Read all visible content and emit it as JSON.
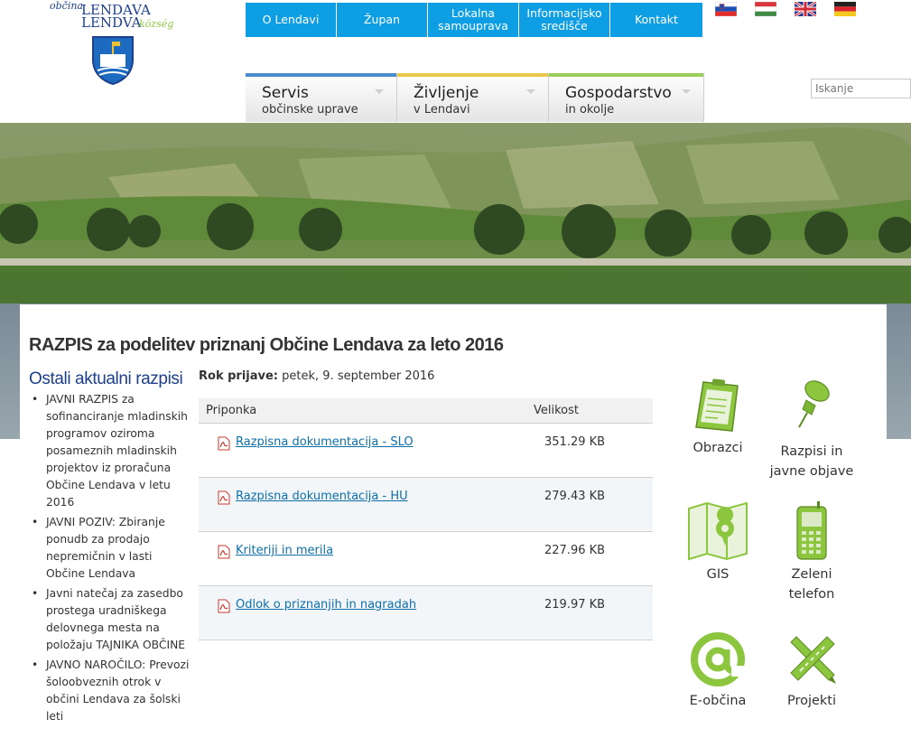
{
  "logo": {
    "line_small": "občina",
    "line1": "LENDAVA",
    "line2": "LENDVA",
    "line2_suffix": "község"
  },
  "top_nav": [
    {
      "label": "O Lendavi"
    },
    {
      "label": "Župan"
    },
    {
      "label": "Lokalna samouprava"
    },
    {
      "label": "Informacijsko središče"
    },
    {
      "label": "Kontakt"
    }
  ],
  "languages": [
    "flag-si-icon",
    "flag-hu-icon",
    "flag-gb-icon",
    "flag-de-icon"
  ],
  "main_nav": [
    {
      "title": "Servis",
      "subtitle": "občinske uprave",
      "color": "#4a8ccc"
    },
    {
      "title": "Življenje",
      "subtitle": "v Lendavi",
      "color": "#e9c74b"
    },
    {
      "title": "Gospodarstvo",
      "subtitle": "in okolje",
      "color": "#9ccc5a"
    }
  ],
  "search": {
    "placeholder": "Iskanje"
  },
  "page_title": "RAZPIS za podelitev priznanj Občine Lendava za leto 2016",
  "sidebar": {
    "heading": "Ostali aktualni razpisi",
    "items": [
      {
        "text": "JAVNI RAZPIS za sofinanciranje mladinskih programov oziroma posameznih mladinskih projektov iz proračuna Občine Lendava v letu 2016"
      },
      {
        "text": "JAVNI POZIV: Zbiranje ponudb za prodajo nepremičnin v lasti Občine Lendava"
      },
      {
        "text": "Javni natečaj za zasedbo prostega uradniškega delovnega mesta na položaju TAJNIKA OBČINE"
      },
      {
        "text": "JAVNO NAROČILO: Prevozi šoloobveznih otrok v občini Lendava za šolski leti"
      }
    ]
  },
  "deadline": {
    "label": "Rok prijave:",
    "value": "petek, 9. september 2016"
  },
  "attachments": {
    "col_name": "Priponka",
    "col_size": "Velikost",
    "rows": [
      {
        "name": "Razpisna dokumentacija - SLO",
        "size": "351.29 KB"
      },
      {
        "name": "Razpisna dokumentacija - HU",
        "size": "279.43 KB"
      },
      {
        "name": "Kriteriji in merila",
        "size": "227.96 KB"
      },
      {
        "name": "Odlok o priznanjih in nagradah",
        "size": "219.97 KB"
      }
    ]
  },
  "tiles": [
    {
      "label": "Obrazci",
      "icon": "clipboard-icon"
    },
    {
      "label": "Razpisi in javne objave",
      "icon": "pushpin-icon"
    },
    {
      "label": "GIS",
      "icon": "map-icon"
    },
    {
      "label": "Zeleni telefon",
      "icon": "phone-icon"
    },
    {
      "label": "E-občina",
      "icon": "at-icon"
    },
    {
      "label": "Projekti",
      "icon": "tools-icon"
    }
  ],
  "accent_color": "#0e9ee3",
  "icon_green": "#8cc63f"
}
